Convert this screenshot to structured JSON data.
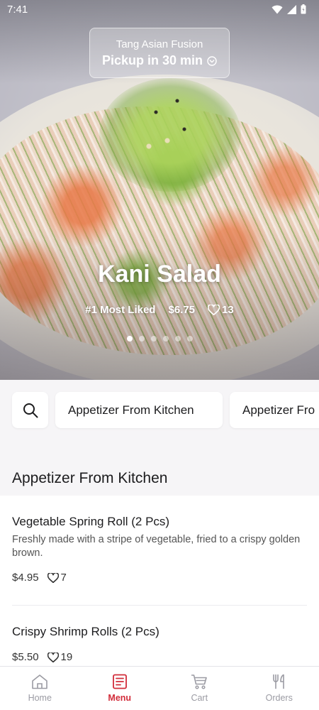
{
  "status_bar": {
    "time": "7:41"
  },
  "store": {
    "name": "Tang Asian Fusion",
    "pickup": "Pickup in 30 min"
  },
  "hero": {
    "title": "Kani Salad",
    "rank": "#1 Most Liked",
    "price": "$6.75",
    "likes": "13",
    "slides": 6,
    "active_slide": 1
  },
  "categories": [
    "Appetizer From Kitchen",
    "Appetizer Fro"
  ],
  "section": {
    "title": "Appetizer From Kitchen"
  },
  "items": [
    {
      "name": "Vegetable Spring Roll (2 Pcs)",
      "description": "Freshly made with a stripe of vegetable, fried to a crispy golden brown.",
      "price": "$4.95",
      "likes": "7"
    },
    {
      "name": "Crispy Shrimp Rolls (2 Pcs)",
      "price": "$5.50",
      "likes": "19"
    }
  ],
  "nav": [
    {
      "label": "Home",
      "icon": "home-icon"
    },
    {
      "label": "Menu",
      "icon": "menu-icon",
      "active": true
    },
    {
      "label": "Cart",
      "icon": "cart-icon"
    },
    {
      "label": "Orders",
      "icon": "orders-icon"
    }
  ],
  "colors": {
    "accent": "#d22c3a",
    "background": "#f6f5f7"
  }
}
